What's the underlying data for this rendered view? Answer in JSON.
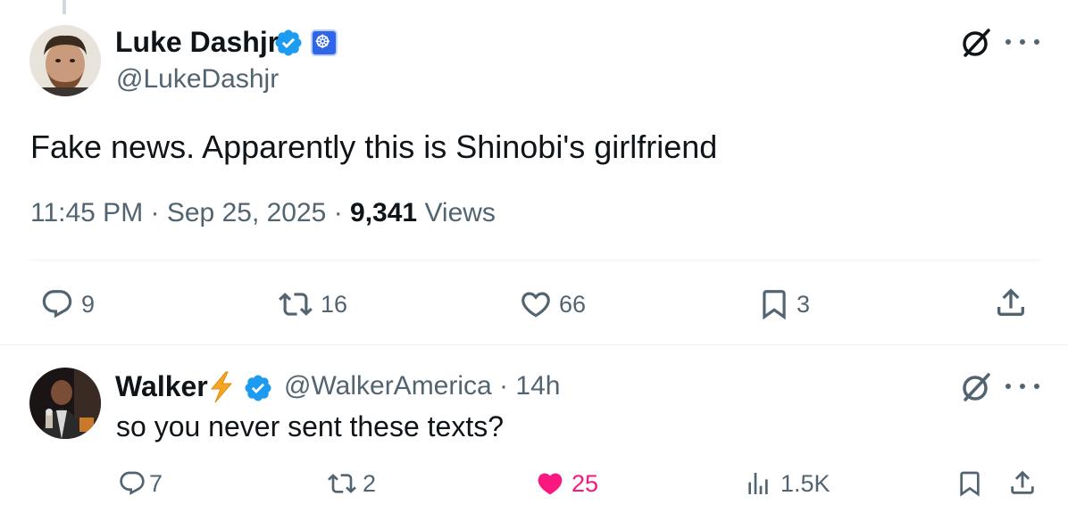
{
  "main_tweet": {
    "author_name": "Luke Dashjr",
    "handle": "@LukeDashjr",
    "text": "Fake news. Apparently this is Shinobi's girlfriend",
    "time": "11:45 PM",
    "separator": " · ",
    "date": "Sep 25, 2025",
    "views_count": "9,341",
    "views_label": " Views",
    "actions": {
      "replies": "9",
      "reposts": "16",
      "likes": "66",
      "bookmarks": "3"
    }
  },
  "reply": {
    "author_name": "Walker",
    "handle": "@WalkerAmerica",
    "time_ago": " · 14h",
    "text": "so you never sent these texts?",
    "actions": {
      "replies": "7",
      "reposts": "2",
      "likes": "25",
      "views": "1.5K"
    }
  },
  "colors": {
    "text_primary": "#0f1419",
    "text_secondary": "#536471",
    "verified_blue": "#1d9bf0",
    "like_pink": "#f91880",
    "bolt_orange": "#f5a623",
    "affiliate_blue": "#2f66e8"
  },
  "icons": {
    "verified": "verified-badge-icon",
    "affiliate": "affiliate-badge-icon",
    "grok": "grok-icon",
    "more": "more-icon",
    "reply": "reply-icon",
    "repost": "repost-icon",
    "like": "heart-icon",
    "bookmark": "bookmark-icon",
    "share": "share-icon",
    "views": "views-icon",
    "bolt": "lightning-bolt-icon"
  }
}
